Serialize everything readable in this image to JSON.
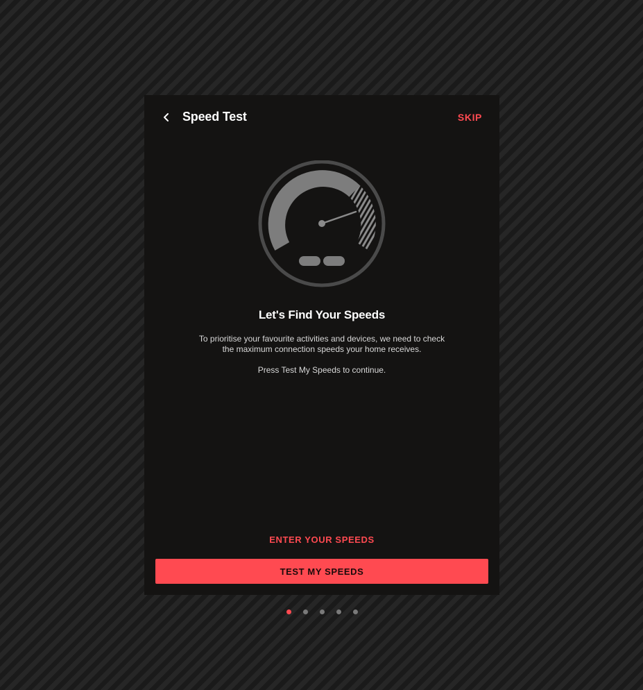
{
  "header": {
    "back_icon": "chevron-left-icon",
    "title": "Speed Test",
    "skip_label": "SKIP"
  },
  "illustration": {
    "icon": "speedometer-icon"
  },
  "content": {
    "heading": "Let's Find Your Speeds",
    "description_line1": "To prioritise your favourite activities and devices, we need to check",
    "description_line2": "the maximum connection speeds your home receives.",
    "instruction": "Press Test My Speeds to continue."
  },
  "actions": {
    "enter_speeds_label": "ENTER YOUR SPEEDS",
    "test_speeds_label": "TEST MY SPEEDS"
  },
  "pager": {
    "total": 5,
    "active_index": 0
  },
  "colors": {
    "accent": "#ff4a51",
    "card_bg": "#141312",
    "text_primary": "#ffffff",
    "text_secondary": "#d9d9d9",
    "dot_inactive": "#7a7a7a"
  }
}
